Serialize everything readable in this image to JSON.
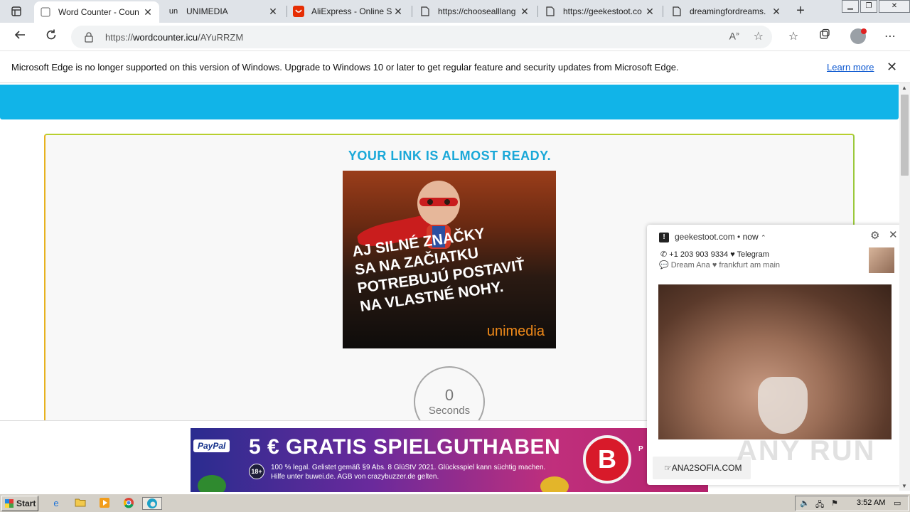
{
  "browser": {
    "tabs": [
      {
        "title": "Word Counter - Coun",
        "favicon": "wordcounter-icon",
        "active": true
      },
      {
        "title": "UNIMEDIA",
        "favicon": "un",
        "active": false
      },
      {
        "title": "AliExpress - Online Sh",
        "favicon": "aliexpress-icon",
        "active": false
      },
      {
        "title": "https://choosealllang",
        "favicon": "page-icon",
        "active": false
      },
      {
        "title": "https://geekestoot.co",
        "favicon": "page-icon",
        "active": false
      },
      {
        "title": "dreamingfordreams.",
        "favicon": "page-icon",
        "active": false
      }
    ],
    "address": {
      "scheme_prefix": "https://",
      "host": "wordcounter.icu",
      "path": "/AYuRRZM"
    },
    "infobar": {
      "message": "Microsoft Edge is no longer supported on this version of Windows. Upgrade to Windows 10 or later to get regular feature and security updates from Microsoft Edge.",
      "link": "Learn more"
    }
  },
  "page": {
    "heading": "YOUR LINK IS ALMOST READY.",
    "banner": {
      "slogan_lines": [
        "AJ SILNÉ ZNAČKY",
        "SA NA ZAČIATKU",
        "POTREBUJÚ POSTAVIŤ",
        "NA VLASTNÉ NOHY."
      ],
      "brand": "unimedia"
    },
    "timer": {
      "value": "0",
      "unit": "Seconds"
    }
  },
  "bottom_ad": {
    "paypal": "PayPal",
    "headline": "5 € GRATIS SPIELGUTHABEN",
    "age": "18+",
    "legal_line1": "100 % legal. Gelistet gemäß §9 Abs. 8 GlüStV 2021. Glücksspiel kann süchtig machen.",
    "legal_line2": "Hilfe unter buwei.de. AGB von crazybuzzer.de gelten.",
    "logo_letter": "B",
    "edge_text": "P"
  },
  "notification": {
    "site": "geekestoot.com",
    "time": "now",
    "line1": "+1 203 903 9334 ♥ Telegram",
    "line2": "Dream Ana ♥ frankfurt am main",
    "cta": "☞ANA2SOFIA.COM"
  },
  "watermark": "ANY RUN",
  "taskbar": {
    "start": "Start",
    "time": "3:52 AM"
  },
  "colors": {
    "header_band": "#11b4e8",
    "heading": "#1aa8d8",
    "brand_orange": "#f08a1a"
  }
}
